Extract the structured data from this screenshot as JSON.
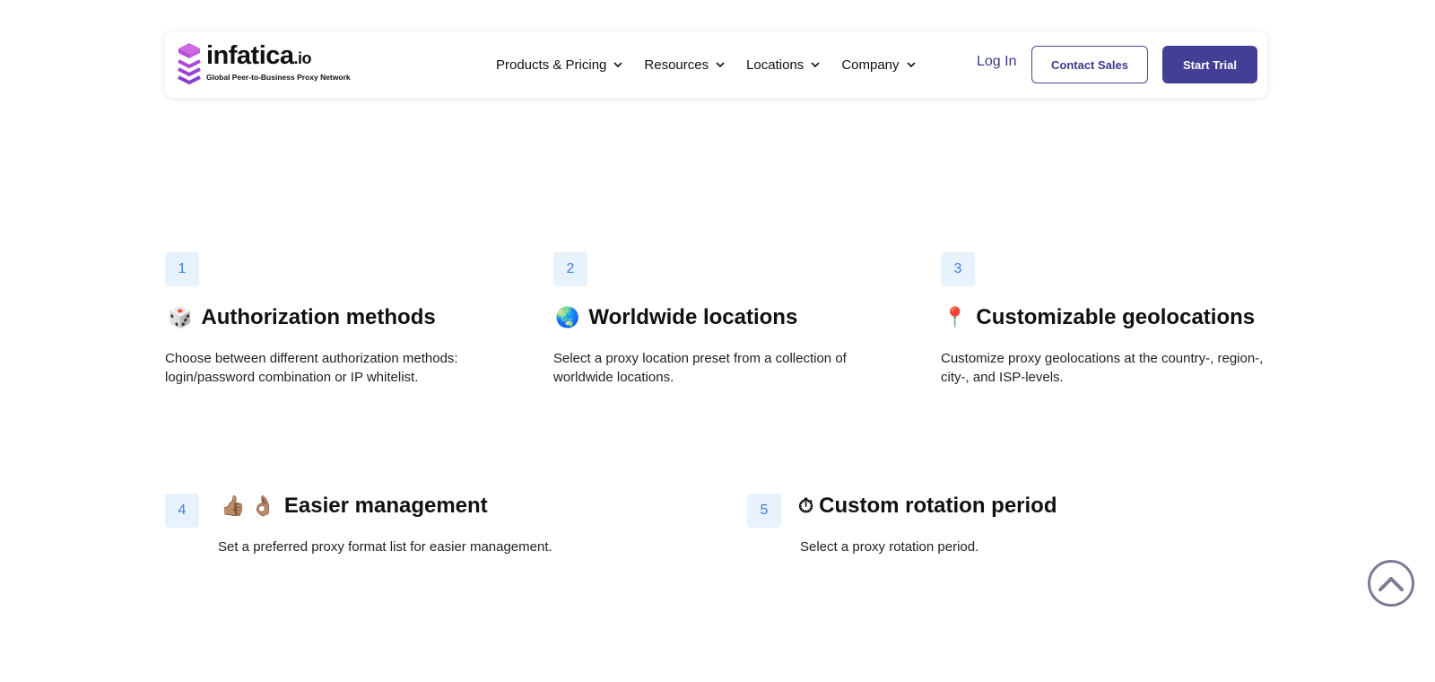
{
  "brand": {
    "name": "infatica",
    "tld": ".io",
    "tagline": "Global Peer-to-Business Proxy Network",
    "colors": {
      "primary": "#433f96",
      "logo_top": "#d06ae0",
      "logo_bottom": "#8a3fd0",
      "badge_bg": "#e8f2fd",
      "badge_text": "#3d7fd8"
    }
  },
  "nav": {
    "items": [
      {
        "label": "Products & Pricing",
        "icon": "chevron-down-icon"
      },
      {
        "label": "Resources",
        "icon": "chevron-down-icon"
      },
      {
        "label": "Locations",
        "icon": "chevron-down-icon"
      },
      {
        "label": "Company",
        "icon": "chevron-down-icon"
      }
    ],
    "login": "Log In",
    "contact_sales": "Contact Sales",
    "start_trial": "Start Trial"
  },
  "features": [
    {
      "number": "1",
      "emoji": "🎲",
      "title": "Authorization methods",
      "description": "Choose between different authorization methods: login/password combination or IP whitelist."
    },
    {
      "number": "2",
      "emoji": "🌏",
      "title": "Worldwide locations",
      "description": "Select a proxy location preset from a collection of worldwide locations."
    },
    {
      "number": "3",
      "emoji": "📍",
      "title": "Customizable geolocations",
      "description": "Customize proxy geolocations at the country-, region-, city-, and ISP-levels."
    },
    {
      "number": "4",
      "emoji": "👍🏽 👌🏽",
      "title": "Easier management",
      "description": "Set a preferred proxy format list for easier management."
    },
    {
      "number": "5",
      "emoji": "⏱",
      "title": "Custom rotation period",
      "description": "Select a proxy rotation period."
    }
  ],
  "scroll_top": {
    "icon": "chevron-up-icon"
  }
}
